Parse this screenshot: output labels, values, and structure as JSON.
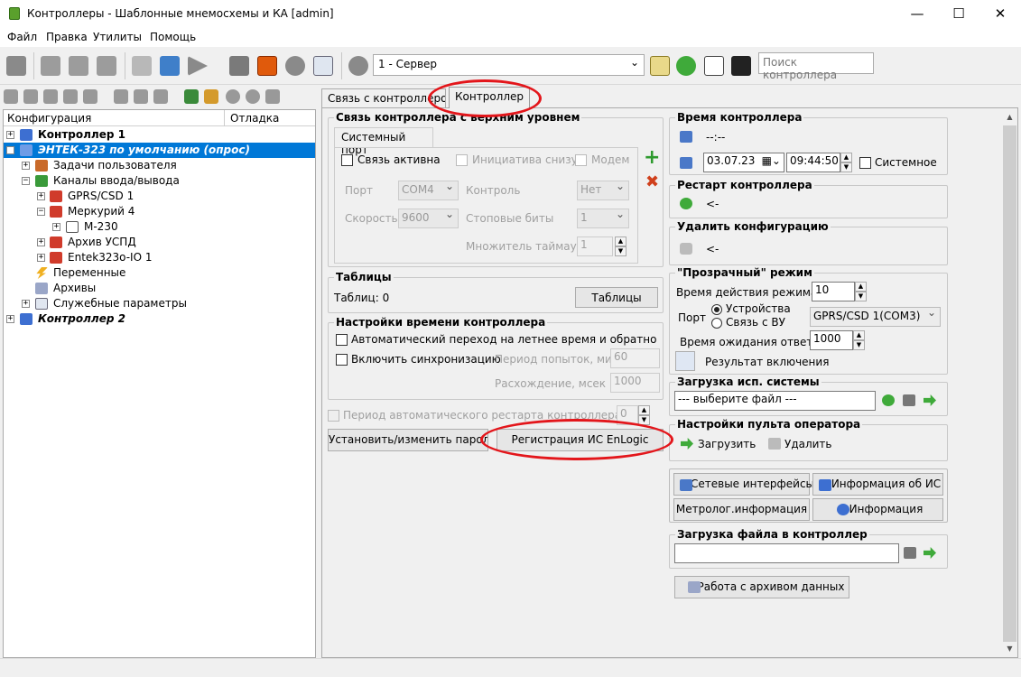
{
  "window": {
    "title": "Контроллеры - Шаблонные мнемосхемы и КА [admin]"
  },
  "menu": [
    "Файл",
    "Правка",
    "Утилиты",
    "Помощь"
  ],
  "toolbar": {
    "server_combo": "1 - Сервер",
    "search_placeholder": "Поиск контроллера"
  },
  "tree": {
    "headers": [
      "Конфигурация",
      "Отладка"
    ],
    "items": [
      "Контроллер 1",
      "ЭНТЕК-323 по умолчанию (опрос)",
      "Задачи пользователя",
      "Каналы ввода/вывода",
      "GPRS/CSD 1",
      "Меркурий 4",
      "M-230",
      "Архив УСПД",
      "Entek323o-IO 1",
      "Переменные",
      "Архивы",
      "Служебные параметры",
      "Контроллер 2"
    ]
  },
  "tabs": [
    "Связь с контроллером",
    "Контроллер"
  ],
  "upper_link": {
    "title": "Связь контроллера с верхним уровнем",
    "subtab": "Системный порт",
    "link_active": "Связь активна",
    "initiative": "Инициатива снизу",
    "modem": "Модем",
    "port_label": "Порт",
    "port_value": "COM4",
    "control_label": "Контроль",
    "control_value": "Нет",
    "speed_label": "Скорость",
    "speed_value": "9600",
    "stop_label": "Стоповые биты",
    "stop_value": "1",
    "timeout_label": "Множитель таймаута",
    "timeout_value": "1"
  },
  "tables": {
    "title": "Таблицы",
    "count": "Таблиц: 0",
    "button": "Таблицы"
  },
  "time_settings": {
    "title": "Настройки времени контроллера",
    "dst": "Автоматический переход на летнее время и обратно",
    "sync": "Включить синхронизацию",
    "period_label": "Период попыток, мин",
    "period_value": "60",
    "diff_label": "Расхождение, мсек",
    "diff_value": "1000"
  },
  "restart_period": {
    "label": "Период автоматического рестарта контроллера, час",
    "value": "0"
  },
  "buttons": {
    "password": "Установить/изменить пароль",
    "register": "Регистрация ИС EnLogic"
  },
  "controller_time": {
    "title": "Время контроллера",
    "value": "--:--",
    "date": "03.07.23",
    "time": "09:44:50",
    "system": "Системное"
  },
  "restart": {
    "title": "Рестарт контроллера",
    "value": "<-"
  },
  "delete_config": {
    "title": "Удалить конфигурацию",
    "value": "<-"
  },
  "transparent": {
    "title": "\"Прозрачный\" режим",
    "duration_label": "Время действия режима",
    "duration_value": "10",
    "port_label": "Порт",
    "radio_device": "Устройства",
    "radio_vu": "Связь с ВУ",
    "port_value": "GPRS/CSD 1(COM3)",
    "wait_label": "Время ожидания ответа",
    "wait_value": "1000",
    "result": "Результат включения"
  },
  "load_system": {
    "title": "Загрузка исп. системы",
    "value": "--- выберите файл ---"
  },
  "operator": {
    "title": "Настройки пульта оператора",
    "load": "Загрузить",
    "delete": "Удалить"
  },
  "info_buttons": {
    "net": "Сетевые интерфейсы",
    "is_info": "Информация об ИС",
    "metro": "Метролог.информация",
    "info": "Информация"
  },
  "file_upload": {
    "title": "Загрузка файла в контроллер",
    "value": ""
  },
  "archive_button": "Работа с архивом данных",
  "colors": {
    "highlight": "#0078d7",
    "red_mark": "#e3161b"
  }
}
